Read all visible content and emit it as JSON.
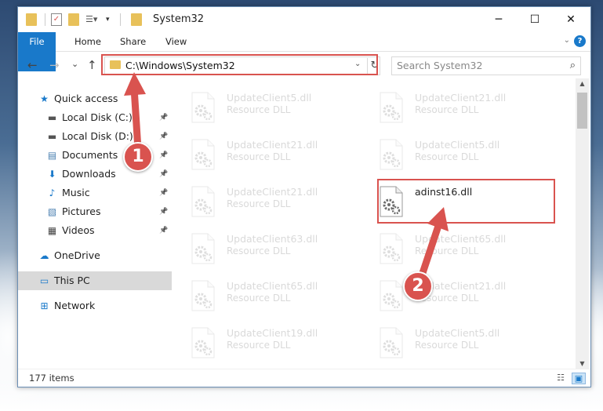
{
  "window": {
    "title": "System32",
    "minimize": "─",
    "maximize": "☐",
    "close": "✕"
  },
  "ribbon": {
    "tabs": [
      "File",
      "Home",
      "Share",
      "View"
    ],
    "help": "?"
  },
  "nav": {
    "back": "←",
    "forward": "→",
    "recent": "⌄",
    "up": "↑",
    "address": "C:\\Windows\\System32",
    "refresh": "↻",
    "search_placeholder": "Search System32",
    "search_icon": "⌕"
  },
  "sidebar": {
    "items": [
      {
        "label": "Quick access",
        "icon": "star-icon",
        "glyph": "★",
        "color": "#1979ca",
        "pinned": false
      },
      {
        "label": "Local Disk (C:)",
        "icon": "drive-icon",
        "glyph": "▬",
        "color": "#555555",
        "pinned": true
      },
      {
        "label": "Local Disk (D:)",
        "icon": "drive-icon",
        "glyph": "▬",
        "color": "#555555",
        "pinned": true
      },
      {
        "label": "Documents",
        "icon": "document-icon",
        "glyph": "▤",
        "color": "#4a7fb0",
        "pinned": true
      },
      {
        "label": "Downloads",
        "icon": "download-icon",
        "glyph": "⬇",
        "color": "#1979ca",
        "pinned": true
      },
      {
        "label": "Music",
        "icon": "music-icon",
        "glyph": "♪",
        "color": "#1979ca",
        "pinned": true
      },
      {
        "label": "Pictures",
        "icon": "picture-icon",
        "glyph": "▧",
        "color": "#4a7fb0",
        "pinned": true
      },
      {
        "label": "Videos",
        "icon": "video-icon",
        "glyph": "▦",
        "color": "#444444",
        "pinned": true
      },
      {
        "label": "OneDrive",
        "icon": "cloud-icon",
        "glyph": "☁",
        "color": "#1979ca",
        "pinned": false
      },
      {
        "label": "This PC",
        "icon": "computer-icon",
        "glyph": "▭",
        "color": "#1979ca",
        "pinned": false,
        "selected": true
      },
      {
        "label": "Network",
        "icon": "network-icon",
        "glyph": "⊞",
        "color": "#1979ca",
        "pinned": false
      }
    ],
    "pin_glyph": "📌"
  },
  "files": [
    {
      "name": "UpdateClient5.dll",
      "type": "Resource DLL",
      "faded": true
    },
    {
      "name": "UpdateClient21.dll",
      "type": "Resource DLL",
      "faded": true
    },
    {
      "name": "UpdateClient21.dll",
      "type": "Resource DLL",
      "faded": true
    },
    {
      "name": "UpdateClient5.dll",
      "type": "Resource DLL",
      "faded": true
    },
    {
      "name": "UpdateClient21.dll",
      "type": "Resource DLL",
      "faded": true
    },
    {
      "name": "adinst16.dll",
      "type": "",
      "faded": false
    },
    {
      "name": "UpdateClient63.dll",
      "type": "Resource DLL",
      "faded": true
    },
    {
      "name": "UpdateClient65.dll",
      "type": "Resource DLL",
      "faded": true
    },
    {
      "name": "UpdateClient65.dll",
      "type": "Resource DLL",
      "faded": true
    },
    {
      "name": "UpdateClient21.dll",
      "type": "Resource DLL",
      "faded": true
    },
    {
      "name": "UpdateClient19.dll",
      "type": "Resource DLL",
      "faded": true
    },
    {
      "name": "UpdateClient5.dll",
      "type": "Resource DLL",
      "faded": true
    }
  ],
  "status": {
    "count": "177 items"
  },
  "annotations": {
    "step1": "1",
    "step2": "2",
    "color": "#d9534f"
  }
}
